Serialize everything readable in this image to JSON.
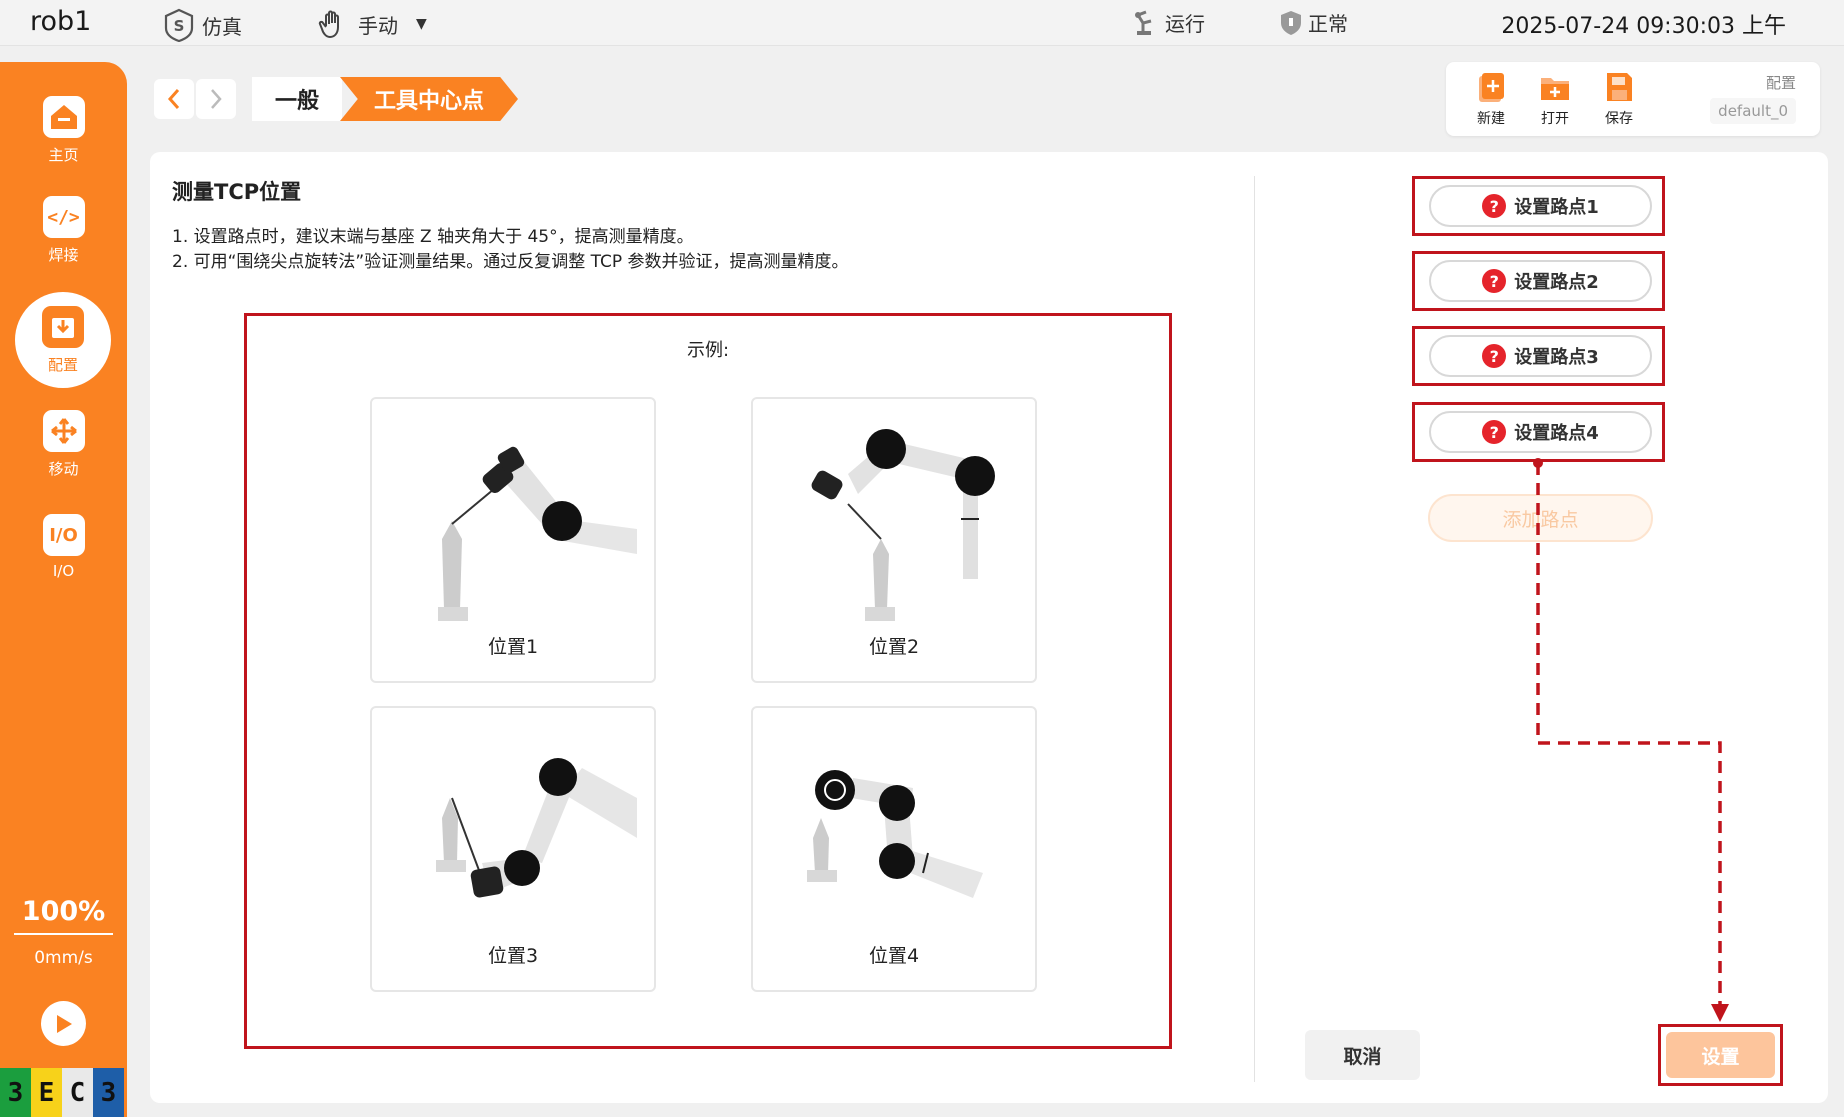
{
  "topbar": {
    "robot_name": "rob1",
    "sim_label": "仿真",
    "mode_label": "手动",
    "run_label": "运行",
    "status_label": "正常",
    "datetime": "2025-07-24 09:30:03 上午"
  },
  "sidebar": {
    "items": [
      {
        "label": "主页",
        "icon": "home-icon"
      },
      {
        "label": "焊接",
        "icon": "code-icon"
      },
      {
        "label": "配置",
        "icon": "download-box-icon",
        "active": true
      },
      {
        "label": "移动",
        "icon": "move-arrows-icon"
      },
      {
        "label": "I/O",
        "icon": "io-icon"
      }
    ],
    "speed_percent": "100%",
    "speed_value": "0mm/s",
    "brand": [
      "3",
      "E",
      "C",
      "3"
    ]
  },
  "breadcrumb": {
    "items": [
      "一般",
      "工具中心点"
    ]
  },
  "toolbox": {
    "new_label": "新建",
    "open_label": "打开",
    "save_label": "保存",
    "config_label": "配置",
    "config_value": "default_0"
  },
  "main": {
    "title": "测量TCP位置",
    "instructions": [
      "1. 设置路点时，建议末端与基座 Z 轴夹角大于 45°，提高测量精度。",
      "2. 可用“围绕尖点旋转法”验证测量结果。通过反复调整 TCP 参数并验证，提高测量精度。"
    ],
    "example_label": "示例:",
    "positions": [
      "位置1",
      "位置2",
      "位置3",
      "位置4"
    ]
  },
  "waypoints": {
    "items": [
      "设置路点1",
      "设置路点2",
      "设置路点3",
      "设置路点4"
    ],
    "help_mark": "?",
    "add_label": "添加路点"
  },
  "actions": {
    "cancel_label": "取消",
    "set_label": "设置"
  },
  "colors": {
    "accent": "#fa8222",
    "highlight_frame": "#c0141c",
    "help_badge": "#e5242b"
  }
}
